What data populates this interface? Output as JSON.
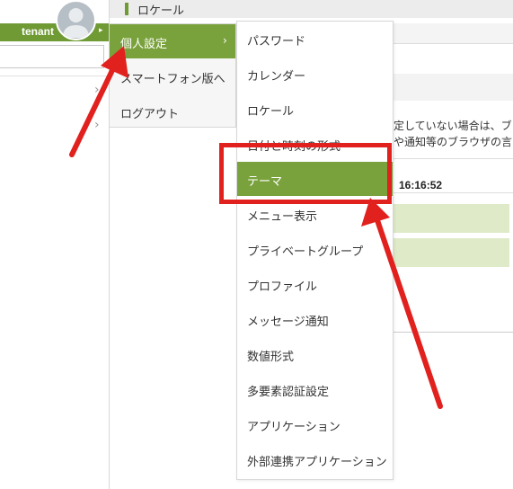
{
  "header": {
    "title": "ロケール"
  },
  "user": {
    "name": "tenant"
  },
  "menu1": {
    "items": [
      {
        "label": "個人設定",
        "active": true
      },
      {
        "label": "スマートフォン版へ"
      },
      {
        "label": "ログアウト"
      }
    ]
  },
  "menu2": {
    "items": [
      {
        "label": "パスワード"
      },
      {
        "label": "カレンダー"
      },
      {
        "label": "ロケール"
      },
      {
        "label": "日付と時刻の形式"
      },
      {
        "label": "テーマ",
        "active": true
      },
      {
        "label": "メニュー表示"
      },
      {
        "label": "プライベートグループ"
      },
      {
        "label": "プロファイル"
      },
      {
        "label": "メッセージ通知"
      },
      {
        "label": "数値形式"
      },
      {
        "label": "多要素認証設定"
      },
      {
        "label": "アプリケーション"
      },
      {
        "label": "外部連携アプリケーション"
      }
    ]
  },
  "content": {
    "line1": "定していない場合は、ブ",
    "line2": "や通知等のブラウザの言",
    "time": "16:16:52"
  },
  "colors": {
    "accent": "#7aa23c",
    "highlight": "#e1211e",
    "cell": "#dfeac8"
  },
  "icons": {
    "avatar": "user-avatar-icon",
    "caret": "caret-right-icon",
    "chevron": "chevron-right-icon"
  }
}
